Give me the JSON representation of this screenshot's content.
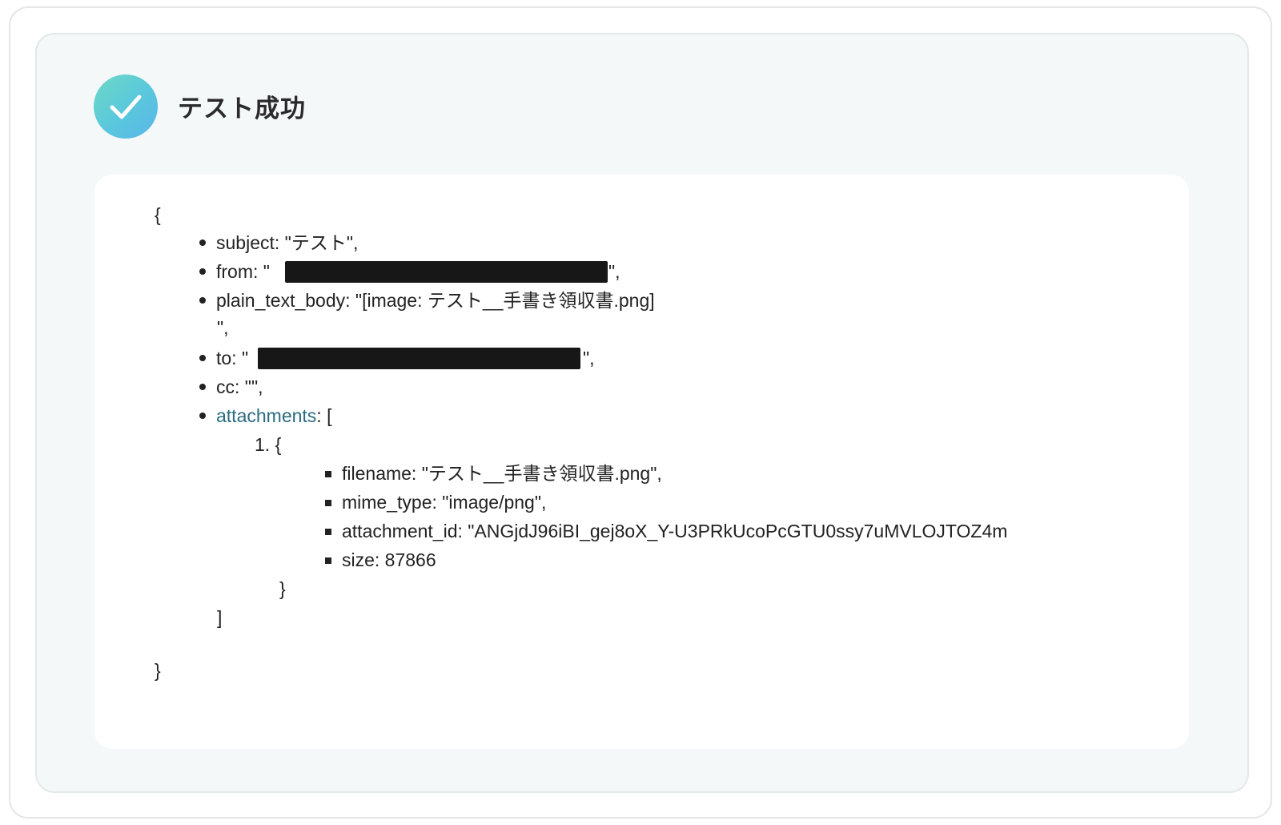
{
  "status": {
    "title": "テスト成功",
    "icon": "check-circle-icon",
    "icon_gradient": [
      "#6ed9c6",
      "#5bb6e8"
    ]
  },
  "json": {
    "open_brace": "{",
    "close_brace": "}",
    "fields": {
      "subject": "subject: \"テスト\",",
      "from_prefix": "from: \"",
      "from_suffix": "\",",
      "plain_text_body_line1": "plain_text_body: \"[image: テスト__手書き領収書.png]",
      "plain_text_body_line2": "\",",
      "to_prefix": "to: \"",
      "to_suffix": "\",",
      "cc": "cc: \"\",",
      "attachments_key": "attachments",
      "attachments_open": ": ["
    },
    "attachment_item": {
      "index_open": "1. {",
      "filename": "filename: \"テスト__手書き領収書.png\",",
      "mime_type": "mime_type: \"image/png\",",
      "attachment_id": "attachment_id: \"ANGjdJ96iBI_gej8oX_Y-U3PRkUcoPcGTU0ssy7uMVLOJTOZ4m",
      "size": "size: 87866",
      "close": "}"
    },
    "attachments_close": "]"
  },
  "colors": {
    "link": "#2b6c80",
    "panel_bg": "#f4f8f8",
    "redaction": "#171717"
  }
}
